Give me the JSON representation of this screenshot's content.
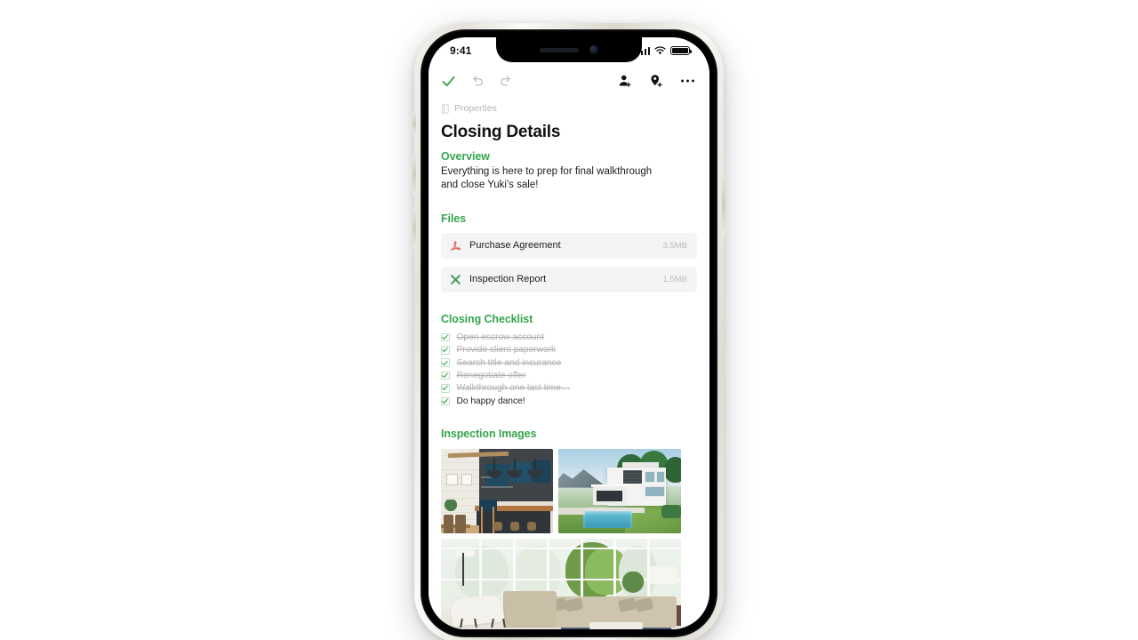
{
  "status_bar": {
    "time": "9:41",
    "signal_icon": "cellular-signal-icon",
    "wifi_icon": "wifi-icon",
    "battery_icon": "battery-full-icon"
  },
  "toolbar": {
    "done_icon": "checkmark-icon",
    "undo_icon": "undo-icon",
    "redo_icon": "redo-icon",
    "add_person_icon": "add-person-icon",
    "add_location_icon": "add-location-icon",
    "more_icon": "more-options-icon"
  },
  "breadcrumb": {
    "icon": "properties-notebook-icon",
    "label": "Properties"
  },
  "document": {
    "title": "Closing Details",
    "overview": {
      "heading": "Overview",
      "body": "Everything is here to prep for final walkthrough and close Yuki's sale!"
    },
    "files": {
      "heading": "Files",
      "items": [
        {
          "name": "Purchase Agreement",
          "size": "3.5MB",
          "type": "pdf",
          "icon": "pdf-file-icon"
        },
        {
          "name": "Inspection Report",
          "size": "1.5MB",
          "type": "excel",
          "icon": "excel-file-icon"
        }
      ]
    },
    "checklist": {
      "heading": "Closing Checklist",
      "items": [
        {
          "label": "Open escrow account",
          "checked": true,
          "struck": true
        },
        {
          "label": "Provide client paperwork",
          "checked": true,
          "struck": true
        },
        {
          "label": "Search title and insurance",
          "checked": true,
          "struck": true
        },
        {
          "label": "Renegotiate offer",
          "checked": true,
          "struck": true
        },
        {
          "label": "Walkthrough one last time…",
          "checked": true,
          "struck": true
        },
        {
          "label": "Do happy dance!",
          "checked": true,
          "struck": false
        }
      ]
    },
    "images": {
      "heading": "Inspection Images",
      "items": [
        {
          "alt": "modern kitchen with navy cabinets",
          "name": "inspection-image-kitchen"
        },
        {
          "alt": "modern white house with pool",
          "name": "inspection-image-exterior"
        },
        {
          "alt": "bright living room with large windows",
          "name": "inspection-image-living-room"
        }
      ]
    }
  },
  "colors": {
    "accent_green": "#36a64f",
    "check_green": "#3aa856",
    "pdf_red": "#e2534c",
    "excel_green": "#3f9c5b",
    "muted_gray": "#b0b0b0",
    "file_row_bg": "#f4f4f4"
  }
}
